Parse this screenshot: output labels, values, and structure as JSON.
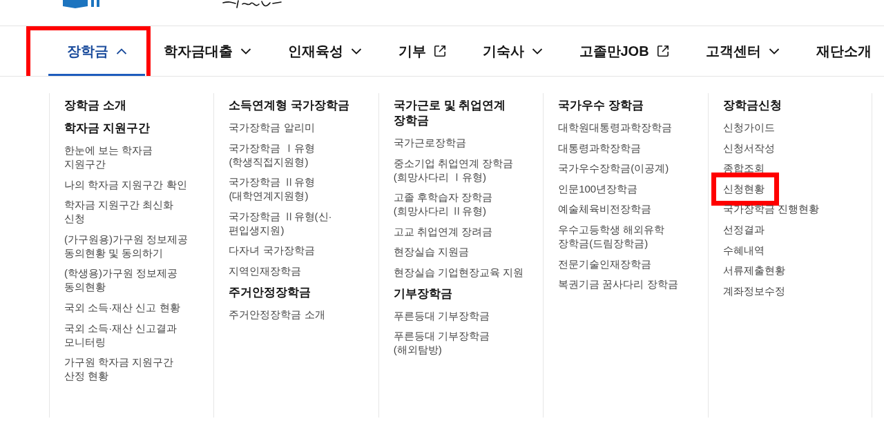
{
  "nav": [
    {
      "label": "장학금",
      "kind": "dropdown",
      "selected": true,
      "expanded": true,
      "highlighted": true
    },
    {
      "label": "학자금대출",
      "kind": "dropdown",
      "selected": false,
      "expanded": false,
      "highlighted": false
    },
    {
      "label": "인재육성",
      "kind": "dropdown",
      "selected": false,
      "expanded": false,
      "highlighted": false
    },
    {
      "label": "기부",
      "kind": "external",
      "selected": false,
      "highlighted": false
    },
    {
      "label": "기숙사",
      "kind": "dropdown",
      "selected": false,
      "expanded": false,
      "highlighted": false
    },
    {
      "label": "고졸만JOB",
      "kind": "external",
      "selected": false,
      "highlighted": false
    },
    {
      "label": "고객센터",
      "kind": "dropdown",
      "selected": false,
      "expanded": false,
      "highlighted": false
    },
    {
      "label": "재단소개",
      "kind": "plain",
      "selected": false,
      "highlighted": false
    }
  ],
  "mega_menu": {
    "columns": [
      {
        "entries": [
          {
            "kind": "heading",
            "label": "장학금 소개",
            "highlighted": false
          },
          {
            "kind": "heading",
            "label": "학자금 지원구간",
            "highlighted": false
          },
          {
            "kind": "link",
            "label": "한눈에 보는 학자금 지원구간",
            "highlighted": false
          },
          {
            "kind": "link",
            "label": "나의 학자금 지원구간 확인",
            "highlighted": false
          },
          {
            "kind": "link",
            "label": "학자금 지원구간 최신화 신청",
            "highlighted": false
          },
          {
            "kind": "link",
            "label": "(가구원용)가구원 정보제공 동의현황 및 동의하기",
            "highlighted": false
          },
          {
            "kind": "link",
            "label": "(학생용)가구원 정보제공 동의현황",
            "highlighted": false
          },
          {
            "kind": "link",
            "label": "국외 소득·재산 신고 현황",
            "highlighted": false
          },
          {
            "kind": "link",
            "label": "국외 소득·재산 신고결과 모니터링",
            "highlighted": false
          },
          {
            "kind": "link",
            "label": "가구원 학자금 지원구간 산정 현황",
            "highlighted": false
          }
        ]
      },
      {
        "entries": [
          {
            "kind": "heading",
            "label": "소득연계형 국가장학금",
            "highlighted": false
          },
          {
            "kind": "link",
            "label": "국가장학금 알리미",
            "highlighted": false
          },
          {
            "kind": "link",
            "label": "국가장학금 Ⅰ유형 (학생직접지원형)",
            "highlighted": false
          },
          {
            "kind": "link",
            "label": "국가장학금 Ⅱ유형 (대학연계지원형)",
            "highlighted": false
          },
          {
            "kind": "link",
            "label": "국가장학금 Ⅱ유형(신·편입생지원)",
            "highlighted": false
          },
          {
            "kind": "link",
            "label": "다자녀 국가장학금",
            "highlighted": false
          },
          {
            "kind": "link",
            "label": "지역인재장학금",
            "highlighted": false
          },
          {
            "kind": "heading",
            "label": "주거안정장학금",
            "highlighted": false
          },
          {
            "kind": "link",
            "label": "주거안정장학금 소개",
            "highlighted": false
          }
        ]
      },
      {
        "entries": [
          {
            "kind": "heading",
            "label": "국가근로 및 취업연계 장학금",
            "highlighted": false
          },
          {
            "kind": "link",
            "label": "국가근로장학금",
            "highlighted": false
          },
          {
            "kind": "link",
            "label": "중소기업 취업연계 장학금 (희망사다리 Ⅰ유형)",
            "highlighted": false
          },
          {
            "kind": "link",
            "label": "고졸 후학습자 장학금 (희망사다리 Ⅱ유형)",
            "highlighted": false
          },
          {
            "kind": "link",
            "label": "고교 취업연계 장려금",
            "highlighted": false
          },
          {
            "kind": "link",
            "label": "현장실습 지원금",
            "highlighted": false
          },
          {
            "kind": "link",
            "label": "현장실습 기업현장교육 지원",
            "highlighted": false
          },
          {
            "kind": "heading",
            "label": "기부장학금",
            "highlighted": false
          },
          {
            "kind": "link",
            "label": "푸른등대 기부장학금",
            "highlighted": false
          },
          {
            "kind": "link",
            "label": "푸른등대 기부장학금 (해외탐방)",
            "highlighted": false
          }
        ]
      },
      {
        "entries": [
          {
            "kind": "heading",
            "label": "국가우수 장학금",
            "highlighted": false
          },
          {
            "kind": "link",
            "label": "대학원대통령과학장학금",
            "highlighted": false
          },
          {
            "kind": "link",
            "label": "대통령과학장학금",
            "highlighted": false
          },
          {
            "kind": "link",
            "label": "국가우수장학금(이공계)",
            "highlighted": false
          },
          {
            "kind": "link",
            "label": "인문100년장학금",
            "highlighted": false
          },
          {
            "kind": "link",
            "label": "예술체육비전장학금",
            "highlighted": false
          },
          {
            "kind": "link",
            "label": "우수고등학생 해외유학 장학금(드림장학금)",
            "highlighted": false
          },
          {
            "kind": "link",
            "label": "전문기술인재장학금",
            "highlighted": false
          },
          {
            "kind": "link",
            "label": "복권기금 꿈사다리 장학금",
            "highlighted": false
          }
        ]
      },
      {
        "entries": [
          {
            "kind": "heading",
            "label": "장학금신청",
            "highlighted": false
          },
          {
            "kind": "link",
            "label": "신청가이드",
            "highlighted": false
          },
          {
            "kind": "link",
            "label": "신청서작성",
            "highlighted": false
          },
          {
            "kind": "link",
            "label": "종합조회",
            "highlighted": false
          },
          {
            "kind": "link",
            "label": "신청현황",
            "highlighted": true
          },
          {
            "kind": "link",
            "label": "국가장학금 진행현황",
            "highlighted": false
          },
          {
            "kind": "link",
            "label": "선정결과",
            "highlighted": false
          },
          {
            "kind": "link",
            "label": "수혜내역",
            "highlighted": false
          },
          {
            "kind": "link",
            "label": "서류제출현황",
            "highlighted": false
          },
          {
            "kind": "link",
            "label": "계좌정보수정",
            "highlighted": false
          }
        ]
      }
    ]
  }
}
